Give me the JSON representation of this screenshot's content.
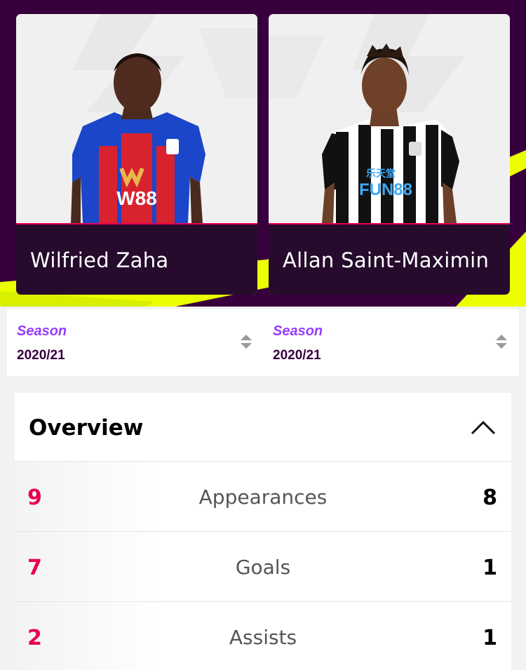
{
  "players": [
    {
      "name": "Wilfried Zaha",
      "kit_sponsor": "W88",
      "kit_brand_mark": "W"
    },
    {
      "name": "Allan Saint-Maximin",
      "kit_sponsor": "FUN88",
      "kit_sponsor_chinese": "乐天堂"
    }
  ],
  "season_selectors": [
    {
      "label": "Season",
      "value": "2020/21"
    },
    {
      "label": "Season",
      "value": "2020/21"
    }
  ],
  "overview": {
    "title": "Overview",
    "stats": [
      {
        "name": "Appearances",
        "left": "9",
        "right": "8"
      },
      {
        "name": "Goals",
        "left": "7",
        "right": "1"
      },
      {
        "name": "Assists",
        "left": "2",
        "right": "1"
      }
    ]
  },
  "colors": {
    "brand_purple": "#37003c",
    "accent_pink": "#e90052",
    "accent_violet": "#963cff",
    "neon_green": "#ebff00",
    "name_bar": "#260b2c"
  },
  "icons": {
    "season_sort": "sort-updown-icon",
    "collapse": "chevron-up-icon"
  }
}
